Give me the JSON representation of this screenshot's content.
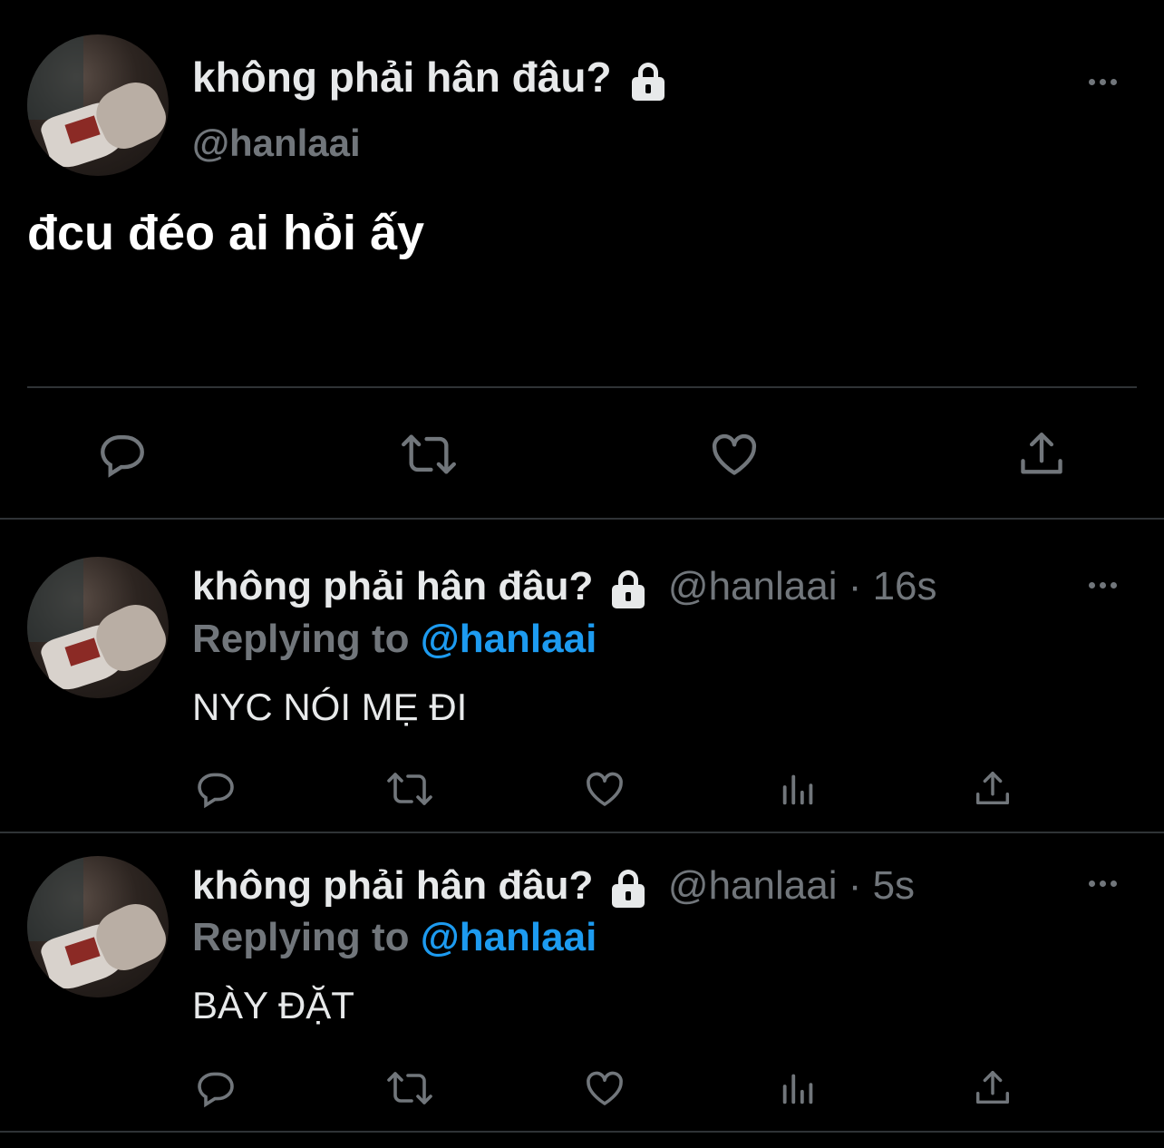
{
  "main_tweet": {
    "display_name": "không phải hân đâu?",
    "handle": "@hanlaai",
    "text": "đcu đéo ai hỏi ấy",
    "actions": [
      "reply-icon",
      "retweet-icon",
      "like-icon",
      "share-icon"
    ]
  },
  "replies": [
    {
      "display_name": "không phải hân đâu?",
      "handle_time": "@hanlaai · 16s",
      "replying_label": "Replying to",
      "replying_to": "@hanlaai",
      "text": "NYC NÓI MẸ ĐI"
    },
    {
      "display_name": "không phải hân đâu?",
      "handle_time": "@hanlaai · 5s",
      "replying_label": "Replying to",
      "replying_to": "@hanlaai",
      "text": "BÀY ĐẶT"
    }
  ],
  "colors": {
    "background": "#000000",
    "text": "#e7e9ea",
    "muted": "#71767b",
    "accent": "#1d9bf0",
    "divider": "#2f3336"
  }
}
